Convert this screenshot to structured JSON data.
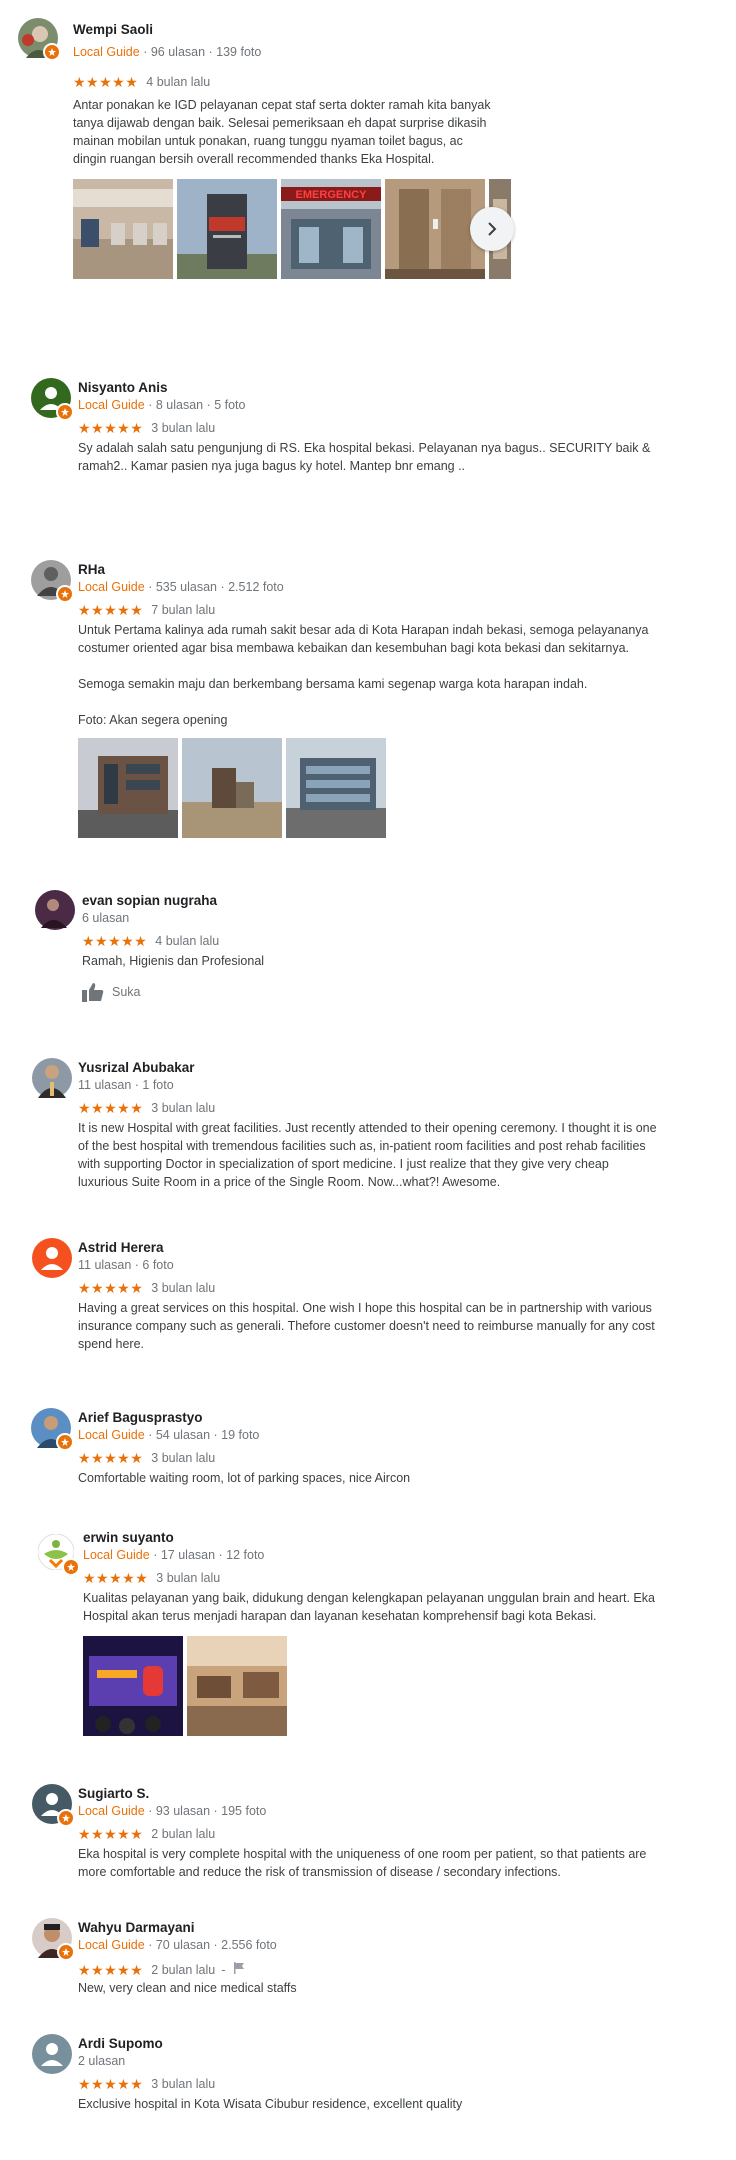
{
  "reviews": [
    {
      "name": "Wempi Saoli",
      "local_guide": "Local Guide",
      "stats": "· 96 ulasan · 139 foto",
      "stars": "★★★★★",
      "time": "4 bulan lalu",
      "text": "Antar ponakan ke IGD pelayanan cepat staf serta dokter ramah kita banyak\ntanya dijawab dengan baik. Selesai pemeriksaan eh dapat surprise dikasih\nmainan mobilan untuk ponakan, ruang tunggu nyaman toilet bagus, ac\ndingin ruangan bersih overall recommended thanks Eka Hospital."
    },
    {
      "name": "Nisyanto Anis",
      "local_guide": "Local Guide",
      "stats": "· 8 ulasan · 5 foto",
      "stars": "★★★★★",
      "time": "3 bulan lalu",
      "text": "Sy adalah salah satu pengunjung di RS. Eka hospital bekasi. Pelayanan nya bagus.. SECURITY baik &\nramah2.. Kamar pasien nya juga bagus ky hotel. Mantep bnr emang .."
    },
    {
      "name": "RHa",
      "local_guide": "Local Guide",
      "stats": "· 535 ulasan · 2.512 foto",
      "stars": "★★★★★",
      "time": "7 bulan lalu",
      "text": "Untuk Pertama kalinya ada rumah sakit besar ada di Kota Harapan indah bekasi, semoga pelayananya\ncostumer oriented agar bisa membawa kebaikan dan kesembuhan bagi kota bekasi dan sekitarnya.\n\nSemoga semakin maju dan berkembang bersama kami segenap warga kota harapan indah.\n\nFoto: Akan segera opening"
    },
    {
      "name": "evan sopian nugraha",
      "stats": "6 ulasan",
      "stars": "★★★★★",
      "time": "4 bulan lalu",
      "text": "Ramah, Higienis dan Profesional",
      "like_label": "Suka"
    },
    {
      "name": "Yusrizal Abubakar",
      "stats": "11 ulasan · 1 foto",
      "stars": "★★★★★",
      "time": "3 bulan lalu",
      "text": "It is new Hospital with great facilities. Just recently attended to their opening ceremony. I thought it is one\nof the best hospital with tremendous facilities such as, in-patient room facilities and post rehab facilities\nwith supporting Doctor in specialization of sport medicine. I just realize that they give very cheap\nluxurious Suite Room in a price of the Single Room. Now...what?! Awesome."
    },
    {
      "name": "Astrid Herera",
      "stats": "11 ulasan · 6 foto",
      "stars": "★★★★★",
      "time": "3 bulan lalu",
      "text": "Having a great services on this hospital. One wish I hope this hospital can be in partnership with various\ninsurance company such as generali. Thefore customer doesn't need to reimburse manually for any cost\nspend here."
    },
    {
      "name": "Arief Bagusprastyo",
      "local_guide": "Local Guide",
      "stats": "· 54 ulasan · 19 foto",
      "stars": "★★★★★",
      "time": "3 bulan lalu",
      "text": "Comfortable waiting room, lot of parking spaces, nice Aircon"
    },
    {
      "name": "erwin suyanto",
      "local_guide": "Local Guide",
      "stats": "· 17 ulasan · 12 foto",
      "stars": "★★★★★",
      "time": "3 bulan lalu",
      "text": "Kualitas pelayanan yang baik, didukung dengan kelengkapan pelayanan unggulan brain and heart. Eka\nHospital akan terus menjadi harapan dan layanan kesehatan komprehensif bagi kota Bekasi."
    },
    {
      "name": "Sugiarto S.",
      "local_guide": "Local Guide",
      "stats": "· 93 ulasan · 195 foto",
      "stars": "★★★★★",
      "time": "2 bulan lalu",
      "text": "Eka hospital is very complete hospital with the uniqueness of one room per patient, so that patients are\nmore comfortable and reduce the risk of transmission of disease / secondary infections."
    },
    {
      "name": "Wahyu Darmayani",
      "local_guide": "Local Guide",
      "stats": "· 70 ulasan · 2.556 foto",
      "stars": "★★★★★",
      "time": "2 bulan lalu",
      "time_suffix": "-",
      "text": "New, very clean and nice medical staffs"
    },
    {
      "name": "Ardi Supomo",
      "stats": "2 ulasan",
      "stars": "★★★★★",
      "time": "3 bulan lalu",
      "text": "Exclusive hospital in Kota Wisata Cibubur residence, excellent quality"
    }
  ],
  "photo_signs": {
    "emergency": "EMERGENCY"
  },
  "colors": {
    "accent": "#e8710a",
    "meta": "#70757a",
    "text": "#3c4043"
  }
}
